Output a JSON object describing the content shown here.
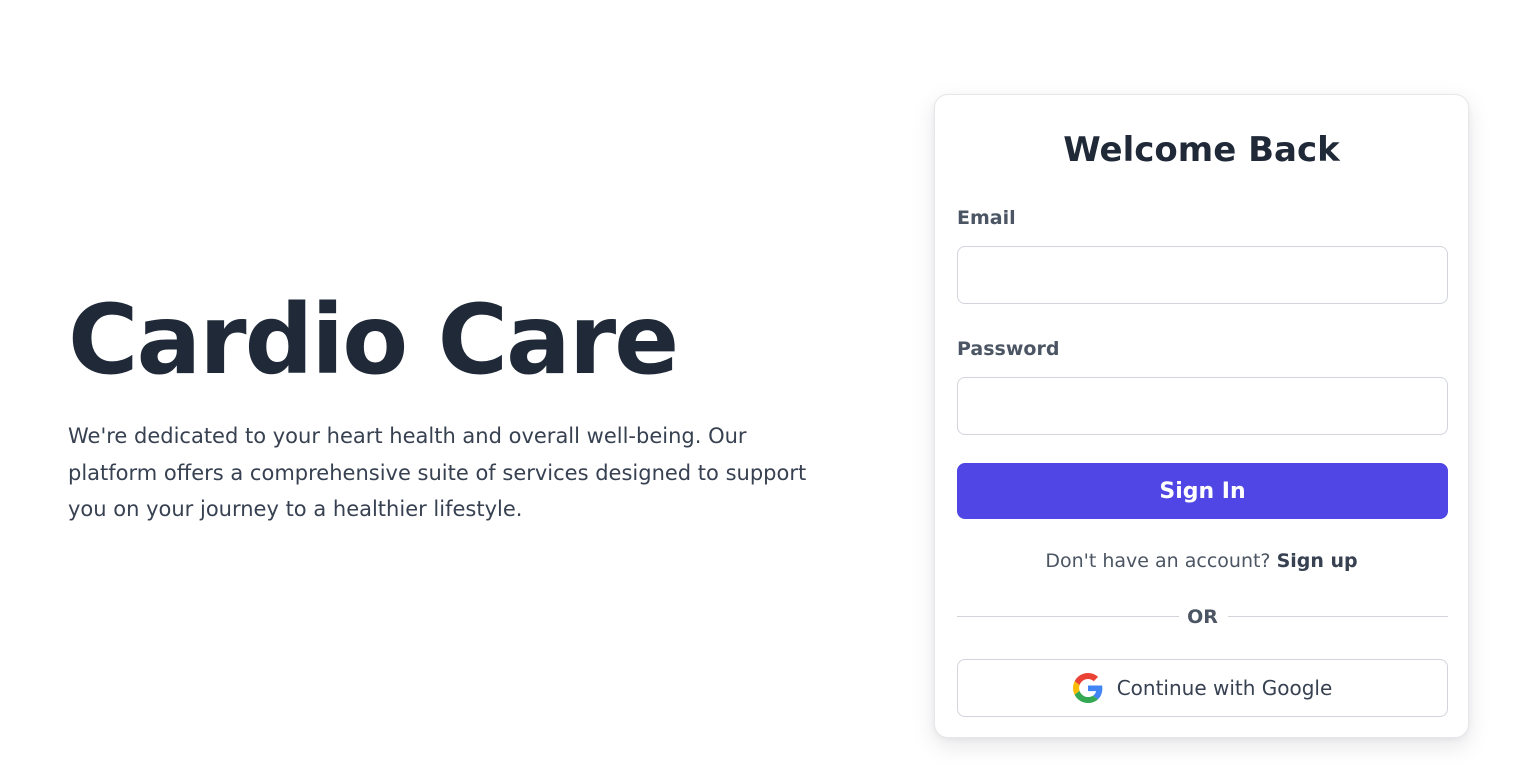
{
  "hero": {
    "title": "Cardio Care",
    "description": "We're dedicated to your heart health and overall well-being. Our platform offers a comprehensive suite of services designed to support you on your journey to a healthier lifestyle."
  },
  "login_card": {
    "title": "Welcome Back",
    "email_label": "Email",
    "email_value": "",
    "password_label": "Password",
    "password_value": "",
    "sign_in_label": "Sign In",
    "no_account_text": "Don't have an account?",
    "sign_up_label": "Sign up",
    "divider_text": "OR",
    "google_label": "Continue with Google",
    "google_icon": "google-icon"
  },
  "colors": {
    "primary": "#4f46e5",
    "heading": "#1f2937",
    "body_text": "#374151",
    "muted_text": "#4b5563",
    "border": "#d1d5db"
  }
}
